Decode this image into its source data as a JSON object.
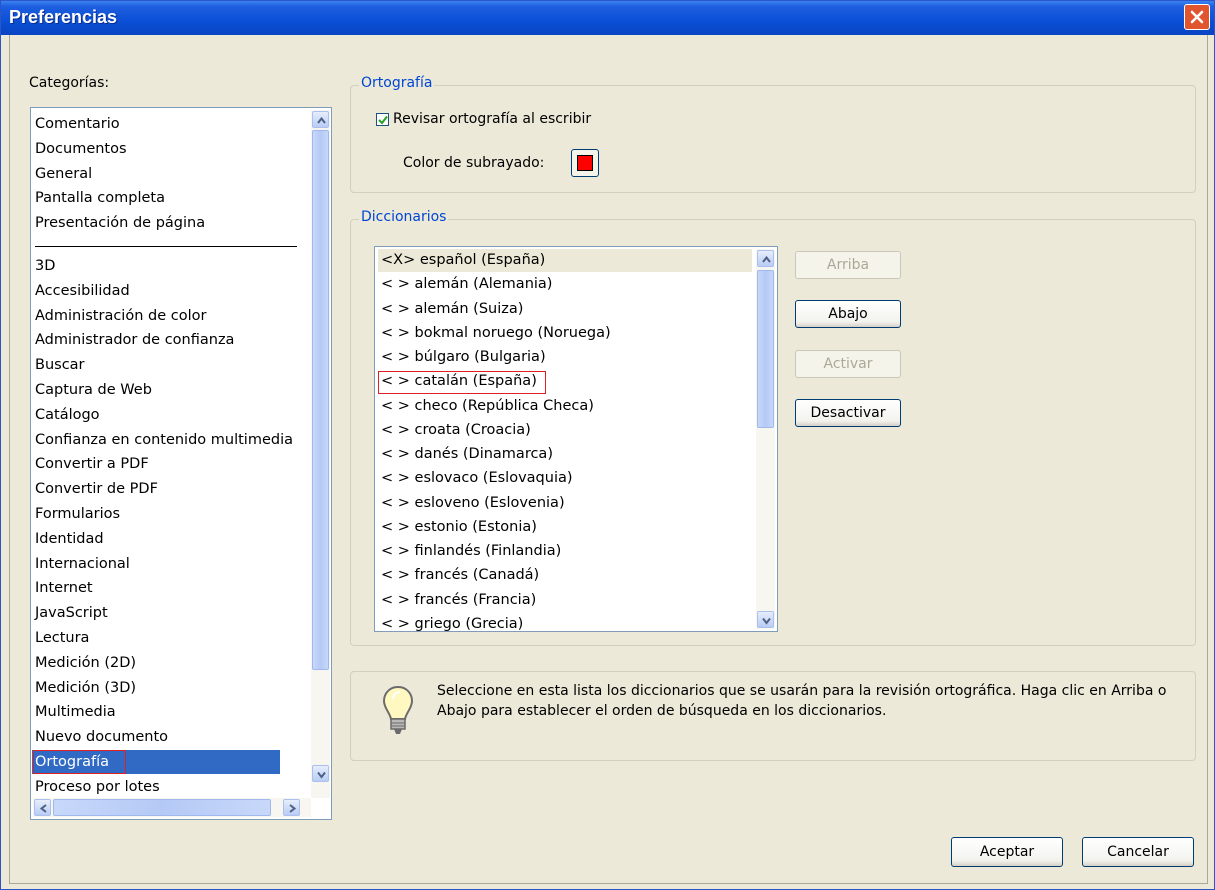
{
  "window": {
    "title": "Preferencias"
  },
  "categories": {
    "label": "Categorías:",
    "top_items": [
      "Comentario",
      "Documentos",
      "General",
      "Pantalla completa",
      "Presentación de página"
    ],
    "items": [
      "3D",
      "Accesibilidad",
      "Administración de color",
      "Administrador de confianza",
      "Buscar",
      "Captura de Web",
      "Catálogo",
      "Confianza en contenido multimedia",
      "Convertir a PDF",
      "Convertir de PDF",
      "Formularios",
      "Identidad",
      "Internacional",
      "Internet",
      "JavaScript",
      "Lectura",
      "Medición (2D)",
      "Medición (3D)",
      "Multimedia",
      "Nuevo documento",
      "Ortografía",
      "Proceso por lotes"
    ],
    "selected": "Ortografía"
  },
  "ortografia": {
    "group_title": "Ortografía",
    "check_label": "Revisar ortografía al escribir",
    "checked": true,
    "color_label": "Color de subrayado:",
    "underline_color": "#ff0000"
  },
  "diccionarios": {
    "group_title": "Diccionarios",
    "items": [
      "<X> español (España)",
      "< > alemán (Alemania)",
      "< > alemán (Suiza)",
      "< > bokmal noruego (Noruega)",
      "< > búlgaro (Bulgaria)",
      "< > catalán (España)",
      "< > checo (República Checa)",
      "< > croata (Croacia)",
      "< > danés (Dinamarca)",
      "< > eslovaco (Eslovaquia)",
      "< > esloveno (Eslovenia)",
      "< > estonio (Estonia)",
      "< > finlandés (Finlandia)",
      "< > francés (Canadá)",
      "< > francés (Francia)",
      "< > griego (Grecia)"
    ],
    "buttons": {
      "up": "Arriba",
      "down": "Abajo",
      "activate": "Activar",
      "deactivate": "Desactivar"
    }
  },
  "info": {
    "icon": "lightbulb-icon",
    "text": "Seleccione en esta lista los diccionarios que se usarán para la revisión ortográfica. Haga clic en Arriba o Abajo para establecer el orden de búsqueda en los diccionarios."
  },
  "footer": {
    "ok": "Aceptar",
    "cancel": "Cancelar"
  }
}
